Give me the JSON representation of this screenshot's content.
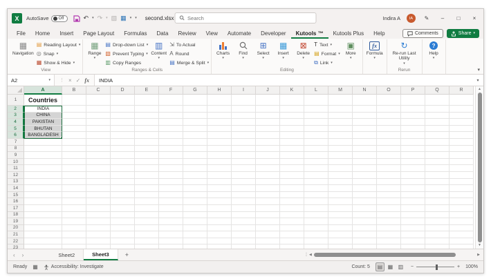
{
  "colors": {
    "excel_green": "#107c41",
    "selection_green": "#1a6b3c",
    "avatar_orange": "#c85a2e",
    "accent_blue": "#2b7cd3"
  },
  "titlebar": {
    "autosave_label": "AutoSave",
    "autosave_state": "Off",
    "filename": "second.xlsx",
    "search_placeholder": "Search",
    "user_name": "Indira A",
    "user_initials": "IA"
  },
  "menu": {
    "tabs": [
      "File",
      "Home",
      "Insert",
      "Page Layout",
      "Formulas",
      "Data",
      "Review",
      "View",
      "Automate",
      "Developer",
      "Kutools ™",
      "Kutools Plus",
      "Help"
    ],
    "active_tab": "Kutools ™",
    "comments_label": "Comments",
    "share_label": "Share"
  },
  "ribbon": {
    "groups": [
      {
        "label": "View",
        "items": [
          {
            "type": "big",
            "label": "Navigation",
            "icon": "navigation-icon",
            "glyph": "▦",
            "color": "#8a8a8a",
            "caret": false
          },
          {
            "type": "stack",
            "items": [
              {
                "label": "Reading Layout",
                "icon": "reading-layout-icon",
                "glyph": "▤",
                "color": "#e0973a",
                "caret": true
              },
              {
                "label": "Snap",
                "icon": "snap-icon",
                "glyph": "◎",
                "color": "#6f6f6f",
                "caret": true
              },
              {
                "label": "Show & Hide",
                "icon": "show-hide-icon",
                "glyph": "▦",
                "color": "#bb4b31",
                "caret": true
              }
            ]
          }
        ]
      },
      {
        "label": "Ranges & Cells",
        "items": [
          {
            "type": "big",
            "label": "Range",
            "icon": "range-icon",
            "glyph": "▦",
            "color": "#74a07c",
            "caret": true
          },
          {
            "type": "stack",
            "items": [
              {
                "label": "Drop-down List",
                "icon": "drop-down-list-icon",
                "glyph": "▤",
                "color": "#4472c4",
                "caret": true
              },
              {
                "label": "Prevent Typing",
                "icon": "prevent-typing-icon",
                "glyph": "▧",
                "color": "#d2622d",
                "caret": true
              },
              {
                "label": "Copy Ranges",
                "icon": "copy-ranges-icon",
                "glyph": "▥",
                "color": "#5a9a68",
                "caret": false
              }
            ]
          },
          {
            "type": "big",
            "label": "Content",
            "icon": "content-icon",
            "glyph": "▥",
            "color": "#4472c4",
            "caret": true
          },
          {
            "type": "stack",
            "items": [
              {
                "label": "To Actual",
                "icon": "to-actual-icon",
                "glyph": "⇲",
                "color": "#5f5f5f",
                "caret": false
              },
              {
                "label": "Round",
                "icon": "round-icon",
                "glyph": "A",
                "color": "#5f5f5f",
                "caret": false
              },
              {
                "label": "Merge & Split",
                "icon": "merge-split-icon",
                "glyph": "▤",
                "color": "#4472c4",
                "caret": true
              }
            ]
          }
        ]
      },
      {
        "label": "Editing",
        "items": [
          {
            "type": "big",
            "label": "Charts",
            "icon": "charts-icon",
            "glyph": "charts",
            "color": "#4472c4",
            "caret": true
          },
          {
            "type": "big",
            "label": "Find",
            "icon": "find-icon",
            "glyph": "search",
            "color": "#5f5f5f",
            "caret": true
          },
          {
            "type": "big",
            "label": "Select",
            "icon": "select-icon",
            "glyph": "⊞",
            "color": "#4472c4",
            "caret": true
          },
          {
            "type": "big",
            "label": "Insert",
            "icon": "insert-icon",
            "glyph": "▦",
            "color": "#3a9ad9",
            "caret": true
          },
          {
            "type": "big",
            "label": "Delete",
            "icon": "delete-icon",
            "glyph": "⊠",
            "color": "#c24934",
            "caret": true
          },
          {
            "type": "stack",
            "items": [
              {
                "label": "Text",
                "icon": "text-icon",
                "glyph": "T",
                "color": "#333333",
                "caret": true
              },
              {
                "label": "Format",
                "icon": "format-icon",
                "glyph": "▤",
                "color": "#d4a017",
                "caret": true
              },
              {
                "label": "Link",
                "icon": "link-icon",
                "glyph": "⧉",
                "color": "#4472c4",
                "caret": true
              }
            ]
          },
          {
            "type": "big",
            "label": "More",
            "icon": "more-icon",
            "glyph": "▣",
            "color": "#5f8f5f",
            "caret": true
          }
        ]
      },
      {
        "label": "",
        "items": [
          {
            "type": "big",
            "label": "Formula",
            "icon": "formula-icon",
            "glyph": "fx",
            "color": "#2b579a",
            "caret": true
          }
        ]
      },
      {
        "label": "Rerun",
        "items": [
          {
            "type": "big",
            "label": "Re-run Last Utility",
            "icon": "rerun-last-utility-icon",
            "glyph": "↻",
            "color": "#2b7cd3",
            "caret": true
          }
        ]
      },
      {
        "label": "",
        "items": [
          {
            "type": "big",
            "label": "Help",
            "icon": "help-icon",
            "glyph": "?",
            "color": "#2b7cd3",
            "caret": true
          }
        ]
      }
    ]
  },
  "formula_bar": {
    "name_box": "A2",
    "value": "INDIA"
  },
  "grid": {
    "columns": [
      "A",
      "B",
      "C",
      "D",
      "E",
      "F",
      "G",
      "H",
      "I",
      "J",
      "K",
      "L",
      "M",
      "N",
      "O",
      "P",
      "Q",
      "R"
    ],
    "row_count": 24,
    "selected_column": "A",
    "selected_rows": [
      2,
      3,
      4,
      5,
      6
    ],
    "active_cell": "A2",
    "selection_range": "A2:A6",
    "cells": {
      "A1": "Countries",
      "A2": "INDIA",
      "A3": "CHINA",
      "A4": "PAKISTAN",
      "A5": "BHUTAN",
      "A6": "BANGLADESH"
    }
  },
  "sheet_tabs": {
    "tabs": [
      "Sheet2",
      "Sheet3"
    ],
    "active_tab": "Sheet3",
    "add_label": "+"
  },
  "status_bar": {
    "mode": "Ready",
    "accessibility": "Accessibility: Investigate",
    "count": "Count: 5",
    "zoom_level": "100%"
  }
}
